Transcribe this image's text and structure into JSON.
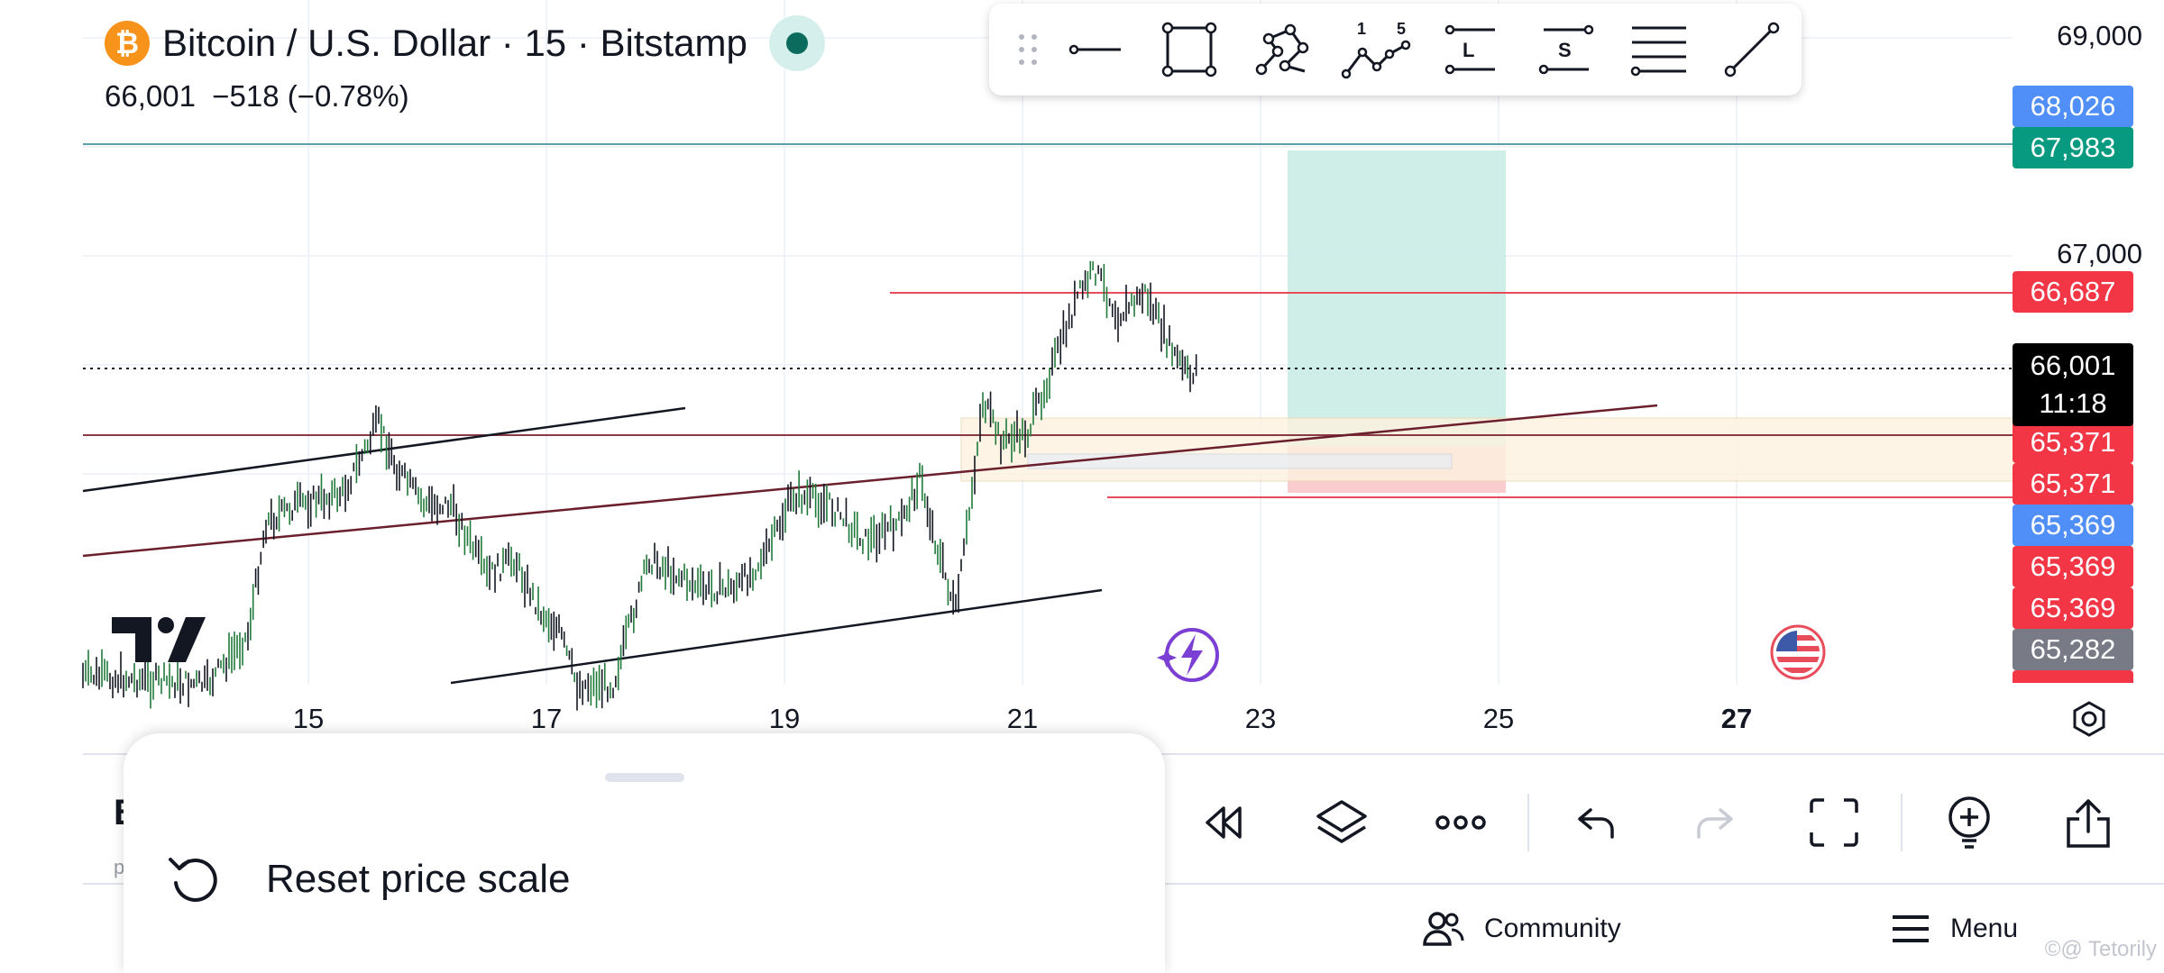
{
  "header": {
    "symbol_title": "Bitcoin / U.S. Dollar · 15 · Bitstamp",
    "coin_glyph": "₿",
    "price_line": "66,001  −518 (−0.78%)"
  },
  "price_axis": {
    "levels": [
      {
        "label": "69,000",
        "value": 69000
      },
      {
        "label": "67,000",
        "value": 67000
      }
    ]
  },
  "price_tags": [
    {
      "label": "68,026",
      "value": 68026,
      "color": "#4f8ff7"
    },
    {
      "label": "67,983",
      "value": 67983,
      "color": "#089981"
    },
    {
      "label": "66,687",
      "value": 66687,
      "color": "#f23645"
    },
    {
      "label": "65,371",
      "value": 65371,
      "color": "#f23645"
    },
    {
      "label": "65,371",
      "value": 65371,
      "color": "#f23645"
    },
    {
      "label": "65,369",
      "value": 65369,
      "color": "#4f8ff7"
    },
    {
      "label": "65,369",
      "value": 65369,
      "color": "#f23645"
    },
    {
      "label": "65,369",
      "value": 65369,
      "color": "#f23645"
    },
    {
      "label": "65,282",
      "value": 65282,
      "color": "#787b86"
    }
  ],
  "current_price": {
    "price": "66,001",
    "countdown": "11:18",
    "value": 66001
  },
  "time_axis": {
    "labels": [
      {
        "label": "15",
        "day": 15,
        "bold": false
      },
      {
        "label": "17",
        "day": 17,
        "bold": false
      },
      {
        "label": "19",
        "day": 19,
        "bold": false
      },
      {
        "label": "21",
        "day": 21,
        "bold": false
      },
      {
        "label": "23",
        "day": 23,
        "bold": false
      },
      {
        "label": "25",
        "day": 25,
        "bold": false
      },
      {
        "label": "27",
        "day": 27,
        "bold": true
      }
    ]
  },
  "drawing_toolbar": {
    "tools": [
      "drag-handle-icon",
      "horizontal-line-icon",
      "rectangle-icon",
      "path-icon",
      "elliott-wave-icon",
      "long-position-icon",
      "short-position-icon",
      "fib-retracement-icon",
      "trend-line-icon"
    ],
    "elliott_labels": [
      "1",
      "5"
    ],
    "long_label": "L",
    "short_label": "S"
  },
  "bottom_toolbar": {
    "tools": [
      "replay-icon",
      "layers-icon",
      "more-icon",
      "undo-icon",
      "redo-icon",
      "fullscreen-icon",
      "alert-add-icon",
      "share-icon"
    ]
  },
  "bottom_nav": {
    "community_label": "Community",
    "menu_label": "Menu"
  },
  "sheet": {
    "reset_label": "Reset price scale"
  },
  "under_sheet": {
    "letter_b": "B",
    "letter_small": "p"
  },
  "watermark": "©@ Tetorily",
  "colors": {
    "up": "#089981",
    "down": "#f23645",
    "accent_blue": "#4f8ff7",
    "bitcoin": "#f7931a"
  }
}
